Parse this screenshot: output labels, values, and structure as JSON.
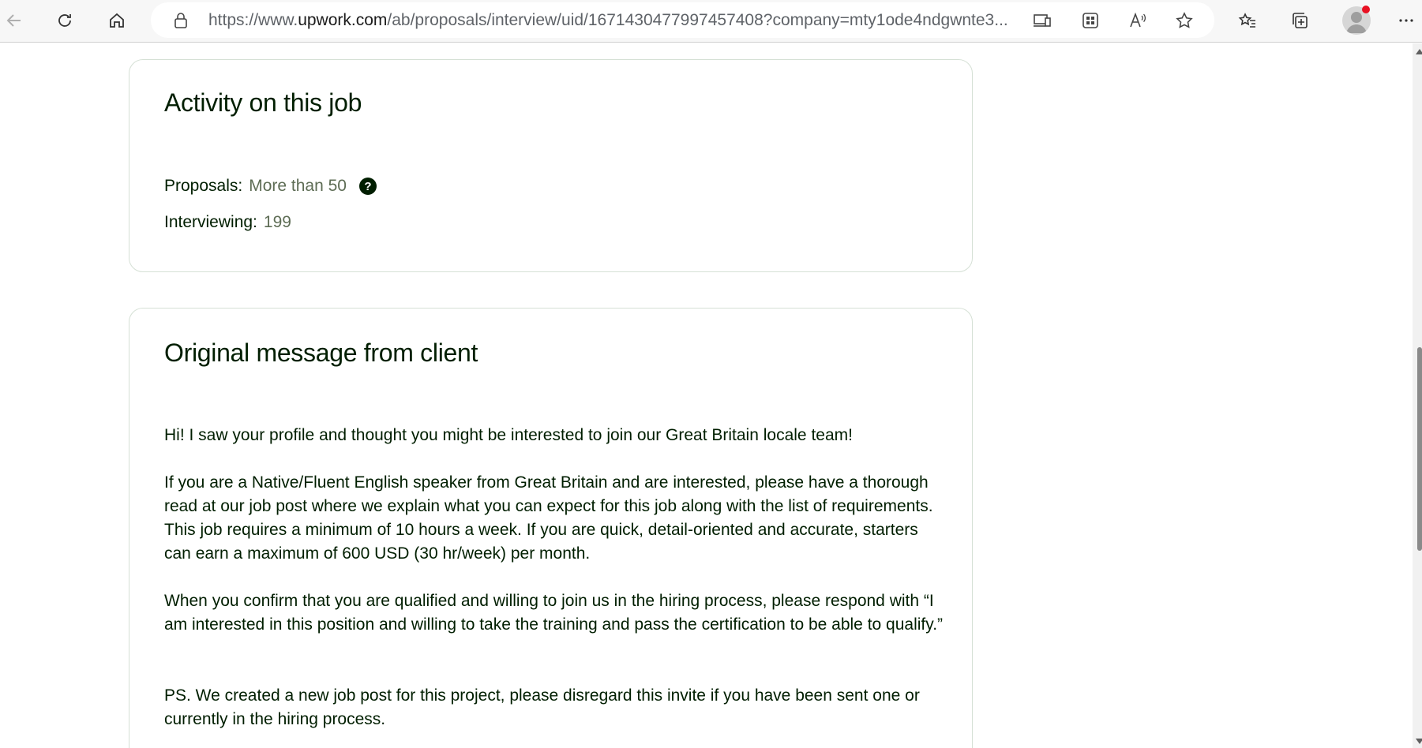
{
  "browser": {
    "url_prefix": "https://www.",
    "url_domain": "upwork.com",
    "url_path": "/ab/proposals/interview/uid/1671430477997457408?company=mty1ode4ndgwnte3...",
    "icons": {
      "back": "arrow-left-icon",
      "refresh": "refresh-icon",
      "home": "home-icon",
      "lock": "lock-icon",
      "app_available": "app-available-icon",
      "qr": "qr-code-icon",
      "read_aloud": "read-aloud-icon",
      "favorite": "star-icon",
      "favorites": "favorites-list-icon",
      "collections": "collections-icon",
      "profile": "profile-avatar-icon",
      "more": "more-icon"
    },
    "notification_color": "#e81123"
  },
  "activity": {
    "title": "Activity on this job",
    "proposals_label": "Proposals:",
    "proposals_value": "More than 50",
    "help_symbol": "?",
    "interviewing_label": "Interviewing:",
    "interviewing_value": "199"
  },
  "message": {
    "title": "Original message from client",
    "paragraphs": [
      "Hi! I saw your profile and thought you might be interested to join our Great Britain locale team!",
      "If you are a Native/Fluent English speaker from Great Britain and are interested, please have a thorough read at our job post where we explain what you can expect for this job along with the list of requirements. This job requires a minimum of 10 hours a week. If you are quick, detail-oriented and accurate, starters can earn a maximum of 600 USD (30 hr/week) per month.",
      "When you confirm that you are qualified and willing to join us in the hiring process, please respond with “I am interested in this position and willing to take the training and pass the certification to be able to qualify.”",
      "PS. We created a new job post for this project, please disregard this invite if you have been sent one or currently in the hiring process."
    ]
  },
  "colors": {
    "text_primary": "#001e00",
    "text_muted": "#5e6d55",
    "card_border": "#d5e0d5"
  }
}
